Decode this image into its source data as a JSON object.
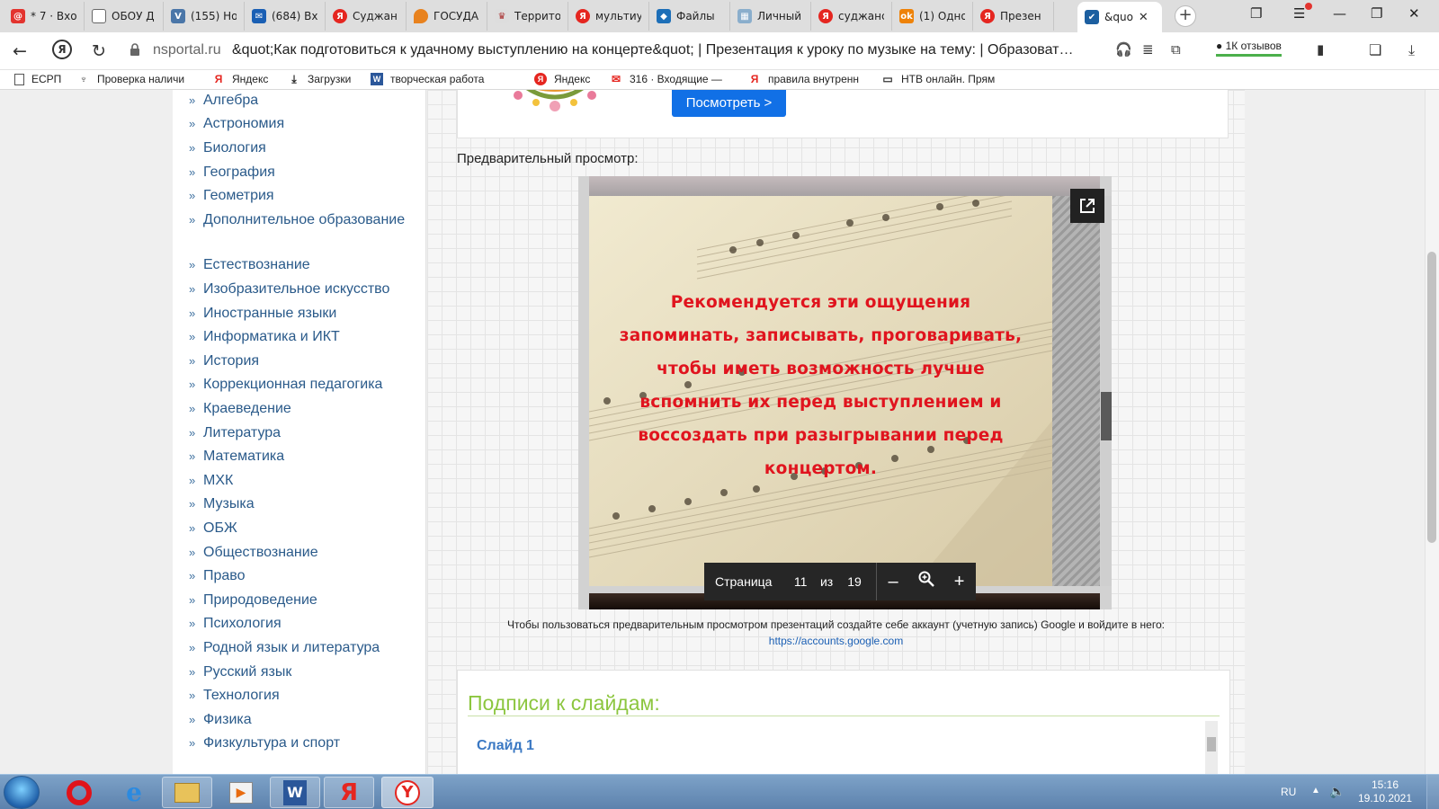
{
  "browser": {
    "tabs": [
      {
        "label": "* 7 · Вхо",
        "icon": "mail-ru-icon",
        "color": "#e3342f"
      },
      {
        "label": "ОБОУ Д",
        "icon": "document-icon",
        "color": "#ffffff"
      },
      {
        "label": "(155) Но",
        "icon": "vk-icon",
        "color": "#4a76a8"
      },
      {
        "label": "(684) Вх",
        "icon": "mail-icon",
        "color": "#1a5fb4"
      },
      {
        "label": "Суджан",
        "icon": "yandex-icon",
        "color": "#e52620"
      },
      {
        "label": "ГОСУДА",
        "icon": "flame-icon",
        "color": "#e8821e"
      },
      {
        "label": "Террито",
        "icon": "emblem-icon",
        "color": "#bbbbbb"
      },
      {
        "label": "мультиу",
        "icon": "yandex-icon",
        "color": "#e52620"
      },
      {
        "label": "Файлы",
        "icon": "cube-icon",
        "color": "#1d6fb8"
      },
      {
        "label": "Личный",
        "icon": "map-icon",
        "color": "#8aaecc"
      },
      {
        "label": "суджанс",
        "icon": "yandex-icon",
        "color": "#e52620"
      },
      {
        "label": "(1) Одно",
        "icon": "ok-icon",
        "color": "#ee8208"
      },
      {
        "label": "Презен",
        "icon": "yandex-icon",
        "color": "#e52620"
      },
      {
        "label": "&quo",
        "icon": "nsportal-icon",
        "color": "#1c5fa0",
        "active": true
      }
    ],
    "address": {
      "domain": "nsportal.ru",
      "title": "&quot;Как подготовиться к удачному выступлению на концерте&quot; | Презентация к уроку по музыке на тему: | Образоват…"
    },
    "reviews_badge": "1К отзывов",
    "bookmarks": [
      {
        "label": "ЕСРП",
        "icon": "page-icon"
      },
      {
        "label": "Проверка наличи",
        "icon": "eagle-icon"
      },
      {
        "label": "Яндекс",
        "icon": "yandex-icon"
      },
      {
        "label": "Загрузки",
        "icon": "download-icon"
      },
      {
        "label": "творческая работа",
        "icon": "word-icon"
      },
      {
        "label": "Яндекс",
        "icon": "yandex-icon"
      },
      {
        "label": "316 · Входящие —",
        "icon": "mail-envelope-icon"
      },
      {
        "label": "правила внутренн",
        "icon": "yandex-icon"
      },
      {
        "label": "НТВ онлайн. Прям",
        "icon": "monitor-icon"
      }
    ]
  },
  "sidebar": {
    "subjects": [
      "Алгебра",
      "Астрономия",
      "Биология",
      "География",
      "Геометрия",
      "Дополнительное образование",
      "Естествознание",
      "Изобразительное искусство",
      "Иностранные языки",
      "Информатика и ИКТ",
      "История",
      "Коррекционная педагогика",
      "Краеведение",
      "Литература",
      "Математика",
      "МХК",
      "Музыка",
      "ОБЖ",
      "Обществознание",
      "Право",
      "Природоведение",
      "Психология",
      "Родной язык и литература",
      "Русский язык",
      "Технология",
      "Физика",
      "Физкультура и спорт"
    ],
    "bullet": "»"
  },
  "ad": {
    "button_label": "Посмотреть >"
  },
  "preview": {
    "label": "Предварительный просмотр:",
    "slide_text": "Рекомендуется эти ощущения запоминать, записывать, проговаривать, чтобы иметь возможность лучше вспомнить их перед выступлением и воссоздать при разыгрывании перед концертом.",
    "pager": {
      "page_word": "Страница",
      "current": "11",
      "of_word": "из",
      "total": "19"
    },
    "hint": "Чтобы пользоваться предварительным просмотром презентаций создайте себе аккаунт (учетную запись) Google и войдите в него:",
    "hint_link": "https://accounts.google.com"
  },
  "captions": {
    "title": "Подписи к слайдам:",
    "first_slide": "Слайд 1"
  },
  "taskbar": {
    "apps": [
      "opera-icon",
      "internet-explorer-icon",
      "file-explorer-icon",
      "media-player-icon",
      "word-icon",
      "yandex-icon",
      "yandex-browser-icon"
    ],
    "lang": "RU",
    "time": "15:16",
    "date": "19.10.2021"
  }
}
